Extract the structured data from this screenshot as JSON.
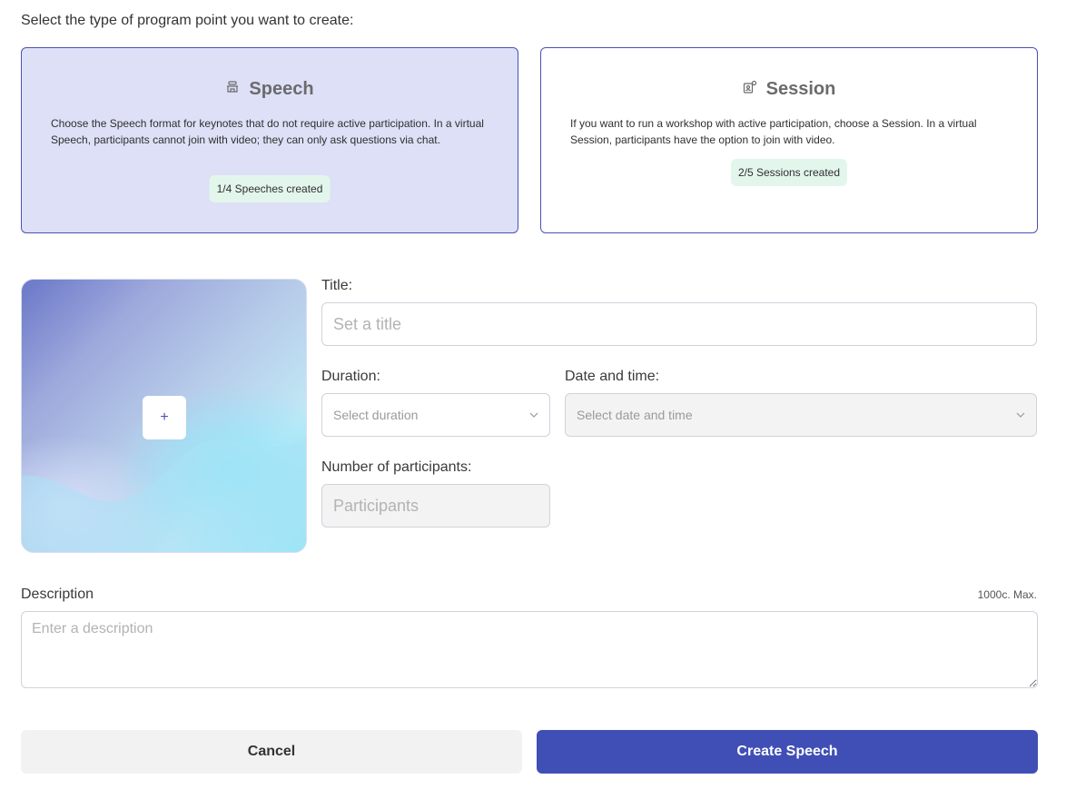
{
  "prompt": "Select the type of program point you want to create:",
  "types": {
    "speech": {
      "title": "Speech",
      "icon": "podium-icon",
      "description": "Choose the Speech format for keynotes that do not require active participation. In a virtual Speech, participants cannot join with video; they can only ask questions via chat.",
      "badge": "1/4 Speeches created",
      "selected": true
    },
    "session": {
      "title": "Session",
      "icon": "session-icon",
      "description": "If you want to run a workshop with active participation, choose a Session. In a virtual Session, participants have the option to join with video.",
      "badge": "2/5 Sessions created",
      "selected": false
    }
  },
  "image": {
    "add_label": "+"
  },
  "form": {
    "title_label": "Title:",
    "title_placeholder": "Set a title",
    "duration_label": "Duration:",
    "duration_placeholder": "Select duration",
    "datetime_label": "Date and time:",
    "datetime_placeholder": "Select date and time",
    "participants_label": "Number of participants:",
    "participants_placeholder": "Participants",
    "description_label": "Description",
    "description_counter": "1000c. Max.",
    "description_placeholder": "Enter a description"
  },
  "actions": {
    "cancel_label": "Cancel",
    "create_label": "Create Speech"
  },
  "colors": {
    "accent": "#3f4fb5",
    "selected_card_bg": "#dde0f7",
    "badge_bg": "#e3f6ec"
  }
}
